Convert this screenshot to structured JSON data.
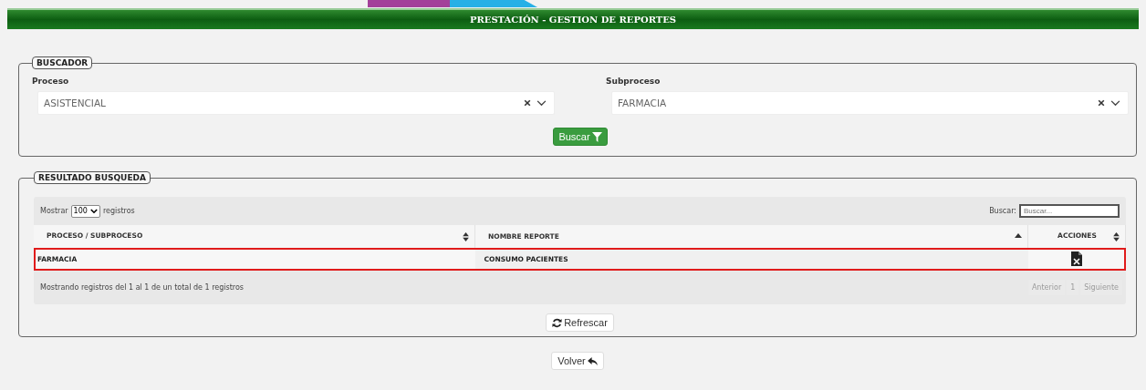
{
  "header": {
    "title": "PRESTACIÓN - GESTION DE REPORTES"
  },
  "buscador": {
    "legend": "BUSCADOR",
    "fields": [
      {
        "label": "Proceso",
        "value": "ASISTENCIAL"
      },
      {
        "label": "Subproceso",
        "value": "FARMACIA"
      }
    ],
    "button": "Buscar"
  },
  "resultado": {
    "legend": "RESULTADO BUSQUEDA",
    "length_prefix": "Mostrar",
    "length_value": "100",
    "length_suffix": "registros",
    "search_label": "Buscar:",
    "search_placeholder": "Buscar...",
    "columns": [
      {
        "label": "PROCESO / SUBPROCESO",
        "sorted": false
      },
      {
        "label": "NOMBRE REPORTE",
        "sorted": true
      },
      {
        "label": "ACCIONES",
        "sorted": false
      }
    ],
    "rows": [
      {
        "proceso": "FARMACIA",
        "nombre": "CONSUMO PACIENTES",
        "selected": true
      }
    ],
    "info": "Mostrando registros del 1 al 1 de un total de 1 registros",
    "pagination": [
      {
        "label": "Anterior",
        "disabled": true
      },
      {
        "label": "1",
        "disabled": true
      },
      {
        "label": "Siguiente",
        "disabled": true
      }
    ],
    "refresh_button": "Refrescar"
  },
  "back_button": "Volver"
}
